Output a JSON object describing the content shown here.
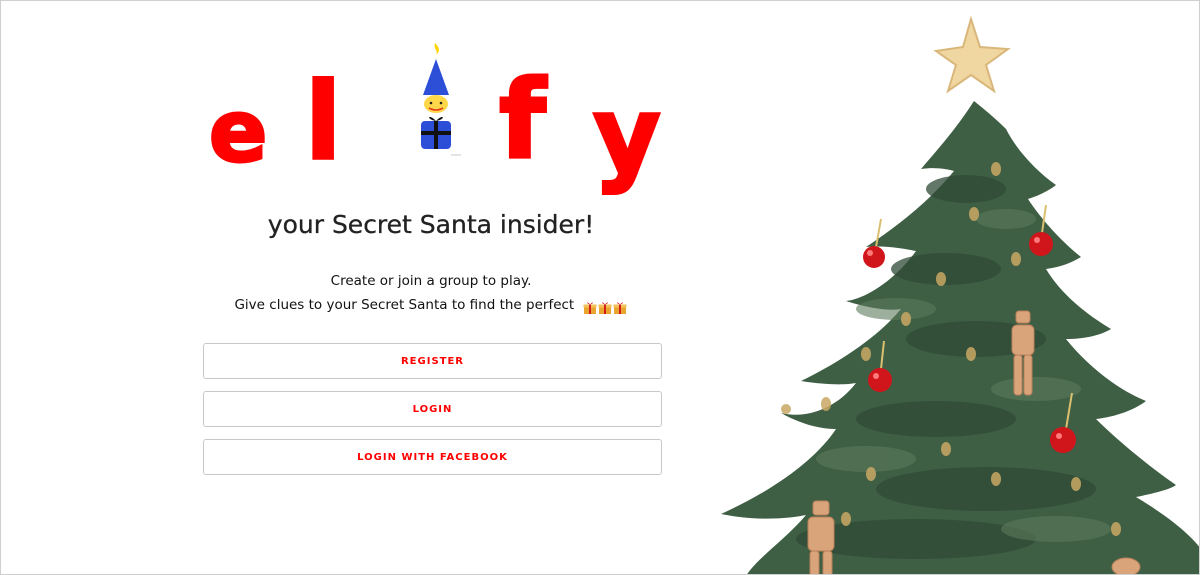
{
  "logo": {
    "letters": [
      "e",
      "l",
      "f",
      "y"
    ]
  },
  "tagline": "your Secret Santa insider!",
  "description": {
    "line1": "Create or join a group to play.",
    "line2": "Give clues to your Secret Santa to find the perfect"
  },
  "buttons": {
    "register": "REGISTER",
    "login": "LOGIN",
    "facebook": "LOGIN WITH FACEBOOK"
  },
  "icons": {
    "elf": "elf-icon",
    "gift": "gift-icon",
    "tree": "christmas-tree-illustration"
  },
  "colors": {
    "accent": "#ff0000",
    "tree_green": "#3f5f45",
    "elf_hat": "#2d4fd8",
    "star": "#f0d6a0",
    "ornament": "#d0151b"
  }
}
